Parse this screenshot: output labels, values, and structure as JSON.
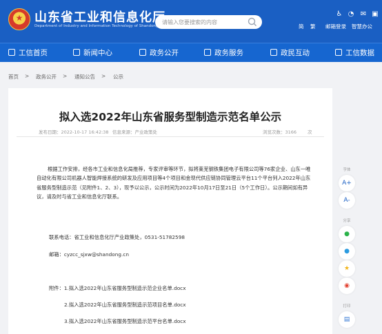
{
  "header": {
    "site_title": "山东省工业和信息化厅",
    "site_subtitle": "Department of Industry and Information Technology of Shandong Province",
    "search_placeholder": "请输入您要搜索的内容",
    "links": [
      "简",
      "繁",
      "邮箱登录",
      "智慧办公"
    ]
  },
  "nav": {
    "items": [
      "工信首页",
      "新闻中心",
      "政务公开",
      "政务服务",
      "政民互动",
      "工信数据"
    ]
  },
  "breadcrumb": [
    "首页",
    ">",
    "政务公开",
    ">",
    "通知公告",
    ">",
    "公示"
  ],
  "article": {
    "title": "拟入选2022年山东省服务型制造示范名单公示",
    "publish_time": "发布日期：2022-10-17 16:42:38",
    "source": "信息来源：产业政策处",
    "views": "浏览次数：3166",
    "views_unit": "次",
    "body": "根据工作安排，经各市工业和信息化局推荐，专家评审等环节，拟将莱芜钢铁集团电子有限公司等76家企业、山东一唯自动化有限公司机器人智能焊接系统的研发及应用项目等4个项目和金现代供应链协同管理云平台11个平台列入2022年山东省服务型制造示范（见附件1、2、3），现予以公示，公示时间为2022年10月17日至21日（5个工作日）。公示期间如有异议，请及时与省工业和信息化厅联系。",
    "contact_phone": "联系电话：省工业和信息化厅产业政策处，0531-51782598",
    "contact_email": "邮箱：cyzcc_sjxw@shandong.cn",
    "attachments": [
      "附件：1.拟入选2022年山东省服务型制造示范企业名单.docx",
      "2.拟入选2022年山东省服务型制造示范项目名单.docx",
      "3.拟入选2022年山东省服务型制造示范平台名单.docx"
    ]
  },
  "side_tools": {
    "font_label": "字体",
    "font_larger": "A+",
    "font_smaller": "A-",
    "share_label": "分享",
    "print_label": "打印"
  },
  "colors": {
    "header_blue": "#1a5fc3",
    "nav_blue": "#1666d0",
    "page_bg": "#f1f2f5"
  }
}
